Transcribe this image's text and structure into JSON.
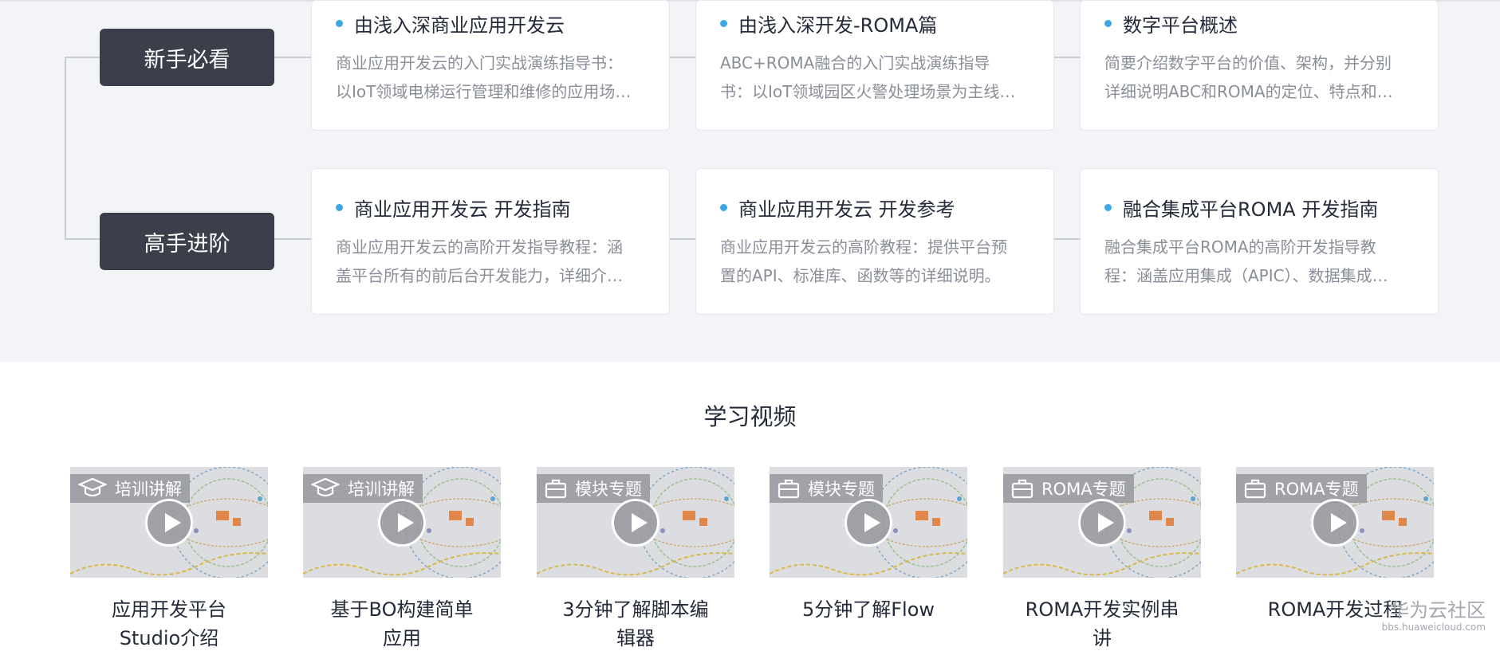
{
  "learning_path": {
    "levels": [
      {
        "label": "新手必看",
        "cards": [
          {
            "title": "由浅入深商业应用开发云",
            "desc": [
              "商业应用开发云的入门实战演练指导书：",
              "以IoT领域电梯运行管理和维修的应用场…"
            ]
          },
          {
            "title": "由浅入深开发-ROMA篇",
            "desc": [
              "ABC+ROMA融合的入门实战演练指导",
              "书：以IoT领域园区火警处理场景为主线…"
            ]
          },
          {
            "title": "数字平台概述",
            "desc": [
              "简要介绍数字平台的价值、架构，并分别",
              "详细说明ABC和ROMA的定位、特点和…"
            ]
          }
        ]
      },
      {
        "label": "高手进阶",
        "cards": [
          {
            "title": "商业应用开发云 开发指南",
            "desc": [
              "商业应用开发云的高阶开发指导教程：涵",
              "盖平台所有的前后台开发能力，详细介…"
            ]
          },
          {
            "title": "商业应用开发云 开发参考",
            "desc": [
              "商业应用开发云的高阶教程：提供平台预",
              "置的API、标准库、函数等的详细说明。"
            ]
          },
          {
            "title": "融合集成平台ROMA 开发指南",
            "desc": [
              "融合集成平台ROMA的高阶开发指导教",
              "程：涵盖应用集成（APIC）、数据集成…"
            ]
          }
        ]
      }
    ]
  },
  "videos": {
    "section_title": "学习视频",
    "items": [
      {
        "tag": "培训讲解",
        "tag_icon": "graduation-cap-icon",
        "title_lines": [
          "应用开发平台",
          "Studio介绍"
        ]
      },
      {
        "tag": "培训讲解",
        "tag_icon": "graduation-cap-icon",
        "title_lines": [
          "基于BO构建简单",
          "应用"
        ]
      },
      {
        "tag": "模块专题",
        "tag_icon": "briefcase-icon",
        "title_lines": [
          "3分钟了解脚本编",
          "辑器"
        ]
      },
      {
        "tag": "模块专题",
        "tag_icon": "briefcase-icon",
        "title_lines": [
          "5分钟了解Flow"
        ]
      },
      {
        "tag": "ROMA专题",
        "tag_icon": "briefcase-icon",
        "title_lines": [
          "ROMA开发实例串",
          "讲"
        ]
      },
      {
        "tag": "ROMA专题",
        "tag_icon": "briefcase-icon",
        "title_lines": [
          "ROMA开发过程"
        ]
      }
    ]
  },
  "watermark": {
    "name": "华为云社区",
    "url": "bbs.huaweicloud.com"
  },
  "colors": {
    "accent": "#3aa7e6",
    "label_bg": "#3b3f4a",
    "section_bg": "#f3f4f8"
  }
}
